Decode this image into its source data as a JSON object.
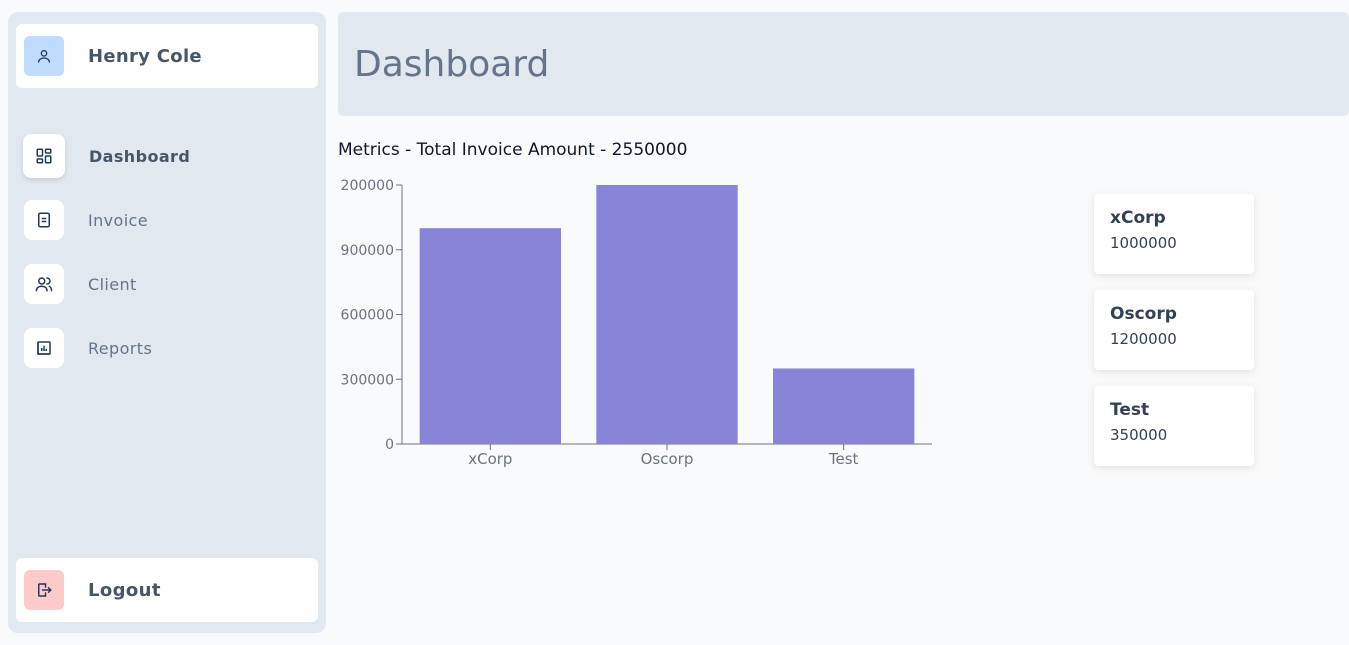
{
  "user": {
    "name": "Henry Cole"
  },
  "nav": [
    {
      "label": "Dashboard",
      "icon": "dashboard-icon"
    },
    {
      "label": "Invoice",
      "icon": "invoice-icon"
    },
    {
      "label": "Client",
      "icon": "users-icon"
    },
    {
      "label": "Reports",
      "icon": "reports-icon"
    }
  ],
  "logout": {
    "label": "Logout",
    "icon": "logout-icon"
  },
  "header": {
    "title": "Dashboard"
  },
  "metrics": {
    "title": "Metrics - Total Invoice Amount - 2550000"
  },
  "cards": [
    {
      "name": "xCorp",
      "value": "1000000"
    },
    {
      "name": "Oscorp",
      "value": "1200000"
    },
    {
      "name": "Test",
      "value": "350000"
    }
  ],
  "chart_data": {
    "type": "bar",
    "categories": [
      "xCorp",
      "Oscorp",
      "Test"
    ],
    "values": [
      1000000,
      1200000,
      350000
    ],
    "title": "",
    "xlabel": "",
    "ylabel": "",
    "ylim": [
      0,
      1200000
    ],
    "yticks": [
      0,
      300000,
      600000,
      900000,
      1200000
    ],
    "ytick_labels": [
      "0",
      "300000",
      "600000",
      "900000",
      "200000"
    ],
    "bar_color": "#8884d8",
    "grid": false
  },
  "colors": {
    "sidebar_bg": "#e2e8f0",
    "profile_icon_bg": "#bfdbfe",
    "logout_icon_bg": "#fecaca",
    "icon_stroke": "#1e3a5f"
  }
}
